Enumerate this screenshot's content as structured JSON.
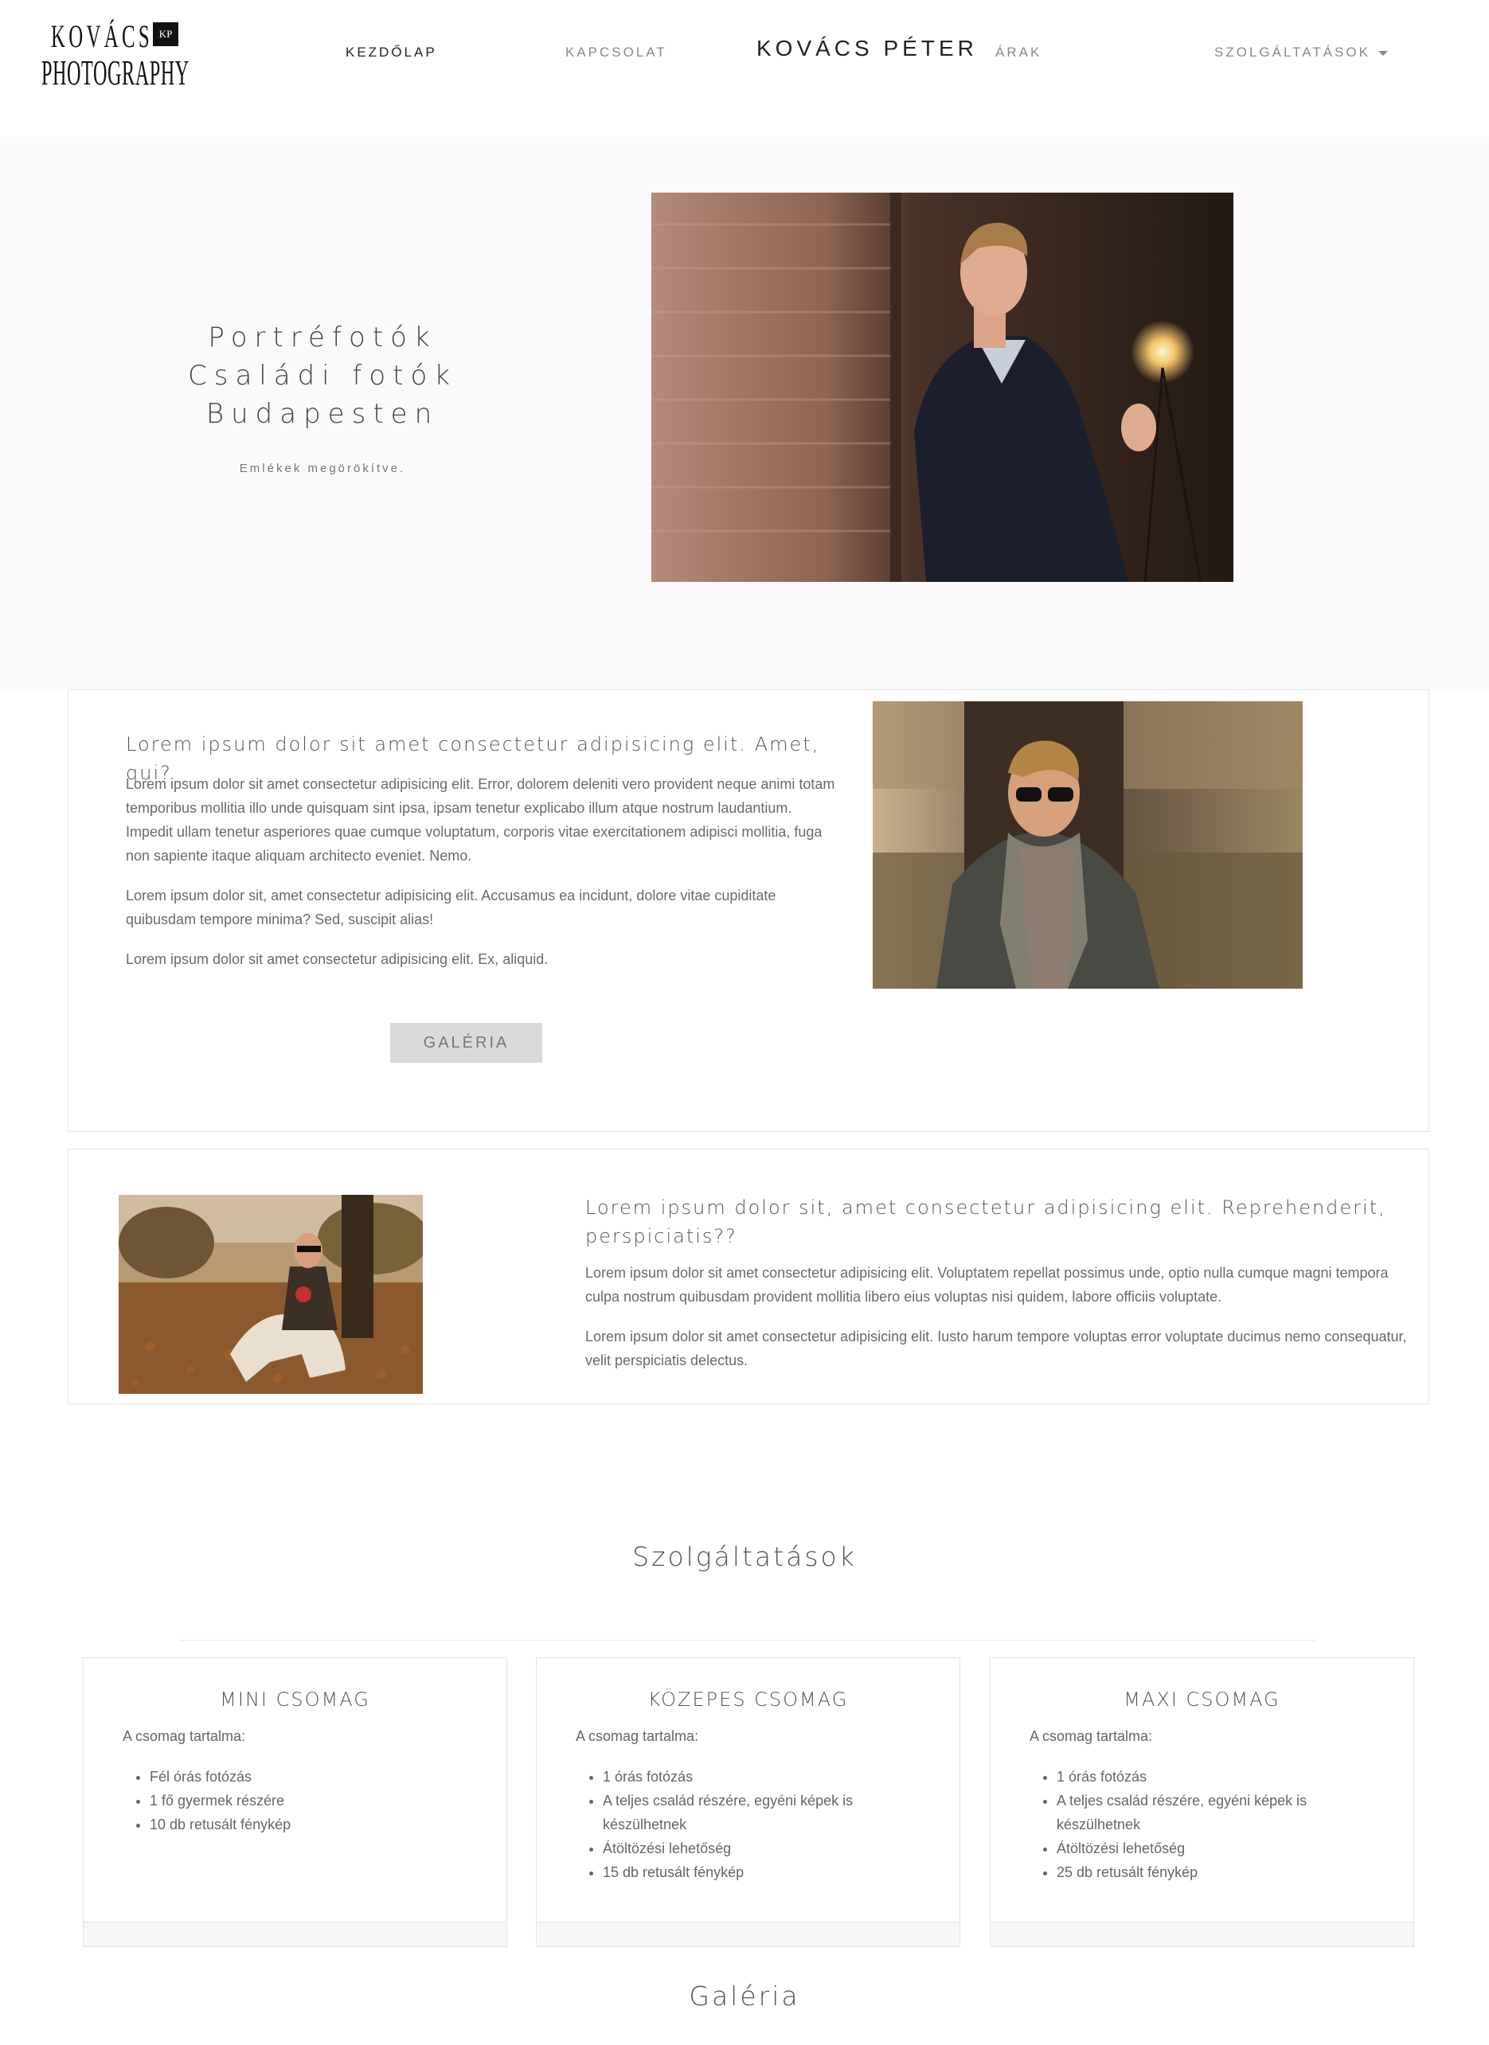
{
  "logo": {
    "line1": "KOVÁCS",
    "badge": "KP",
    "line2": "PHOTOGRAPHY"
  },
  "nav": {
    "home": "KEZDŐLAP",
    "contact": "KAPCSOLAT",
    "brand": "KOVÁCS PÉTER",
    "prices": "ÁRAK",
    "services": "SZOLGÁLTATÁSOK"
  },
  "hero": {
    "title_lines": [
      "Portréfotók",
      "Családi fotók",
      "Budapesten"
    ],
    "subtitle": "Emlékek megörökítve."
  },
  "section1": {
    "heading": "Lorem ipsum dolor sit amet consectetur adipisicing elit. Amet, qui?",
    "paragraphs": [
      "Lorem ipsum dolor sit amet consectetur adipisicing elit. Error, dolorem deleniti vero provident neque animi totam temporibus mollitia illo unde quisquam sint ipsa, ipsam tenetur explicabo illum atque nostrum laudantium. Impedit ullam tenetur asperiores quae cumque voluptatum, corporis vitae exercitationem adipisci mollitia, fuga non sapiente itaque aliquam architecto eveniet. Nemo.",
      "Lorem ipsum dolor sit, amet consectetur adipisicing elit. Accusamus ea incidunt, dolore vitae cupiditate quibusdam tempore minima? Sed, suscipit alias!",
      "Lorem ipsum dolor sit amet consectetur adipisicing elit. Ex, aliquid."
    ],
    "button": "GALÉRIA"
  },
  "section2": {
    "heading": "Lorem ipsum dolor sit, amet consectetur adipisicing elit. Reprehenderit, perspiciatis??",
    "paragraphs": [
      "Lorem ipsum dolor sit amet consectetur adipisicing elit. Voluptatem repellat possimus unde, optio nulla cumque magni tempora culpa nostrum quibusdam provident mollitia libero eius voluptas nisi quidem, labore officiis voluptate.",
      "Lorem ipsum dolor sit amet consectetur adipisicing elit. Iusto harum tempore voluptas error voluptate ducimus nemo consequatur, velit perspiciatis delectus."
    ]
  },
  "services": {
    "title": "Szolgáltatások",
    "packages": [
      {
        "name": "MINI CSOMAG",
        "intro": "A csomag tartalma:",
        "items": [
          "Fél órás fotózás",
          "1 fő gyermek részére",
          "10 db retusált fénykép"
        ]
      },
      {
        "name": "KÖZEPES CSOMAG",
        "intro": "A csomag tartalma:",
        "items": [
          "1 órás fotózás",
          "A teljes család részére, egyéni képek is készülhetnek",
          "Átöltözési lehetőség",
          "15 db retusált fénykép"
        ]
      },
      {
        "name": "MAXI CSOMAG",
        "intro": "A csomag tartalma:",
        "items": [
          "1 órás fotózás",
          "A teljes család részére, egyéni képek is készülhetnek",
          "Átöltözési lehetőség",
          "25 db retusált fénykép"
        ]
      }
    ]
  },
  "gallery": {
    "title": "Galéria"
  }
}
